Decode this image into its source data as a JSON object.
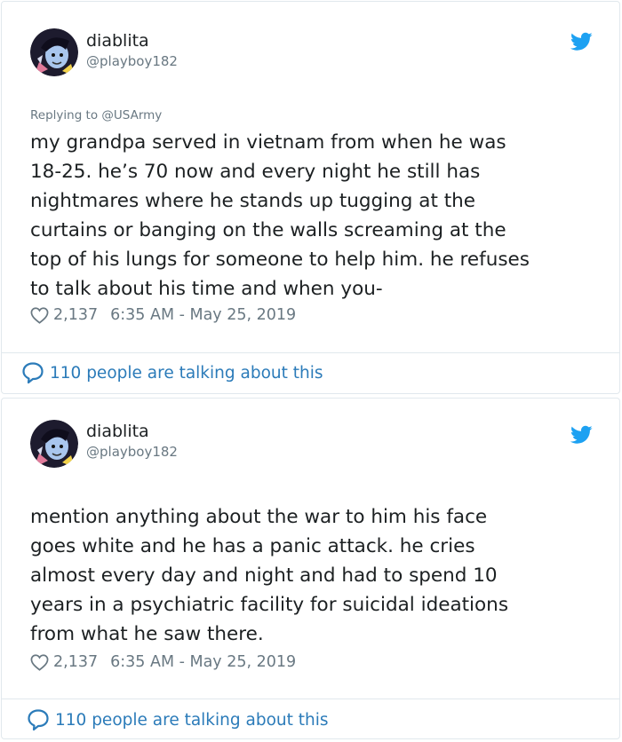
{
  "colors": {
    "text": "#1c2022",
    "muted": "#697882",
    "link": "#2b7bb9",
    "twitter_blue": "#1da1f2",
    "border": "#e1e8ed"
  },
  "tweets": [
    {
      "author_name": "diablita",
      "author_handle": "@playboy182",
      "reply_to": "Replying to @USArmy",
      "text": "my grandpa served in vietnam from when he was\n18-25. he’s 70 now and every night he still has\nnightmares where he stands up tugging at the\ncurtains or banging on the walls screaming at the\ntop of his lungs for someone to help him. he refuses\nto talk about his time and when you-",
      "likes": "2,137",
      "timestamp": "6:35 AM - May 25, 2019",
      "talking": "110 people are talking about this",
      "icons": {
        "avatar": "avatar-image",
        "brand": "twitter-bird-icon",
        "like": "heart-icon",
        "talk": "speech-bubble-icon"
      }
    },
    {
      "author_name": "diablita",
      "author_handle": "@playboy182",
      "text": "mention anything about the war to him his face\ngoes white and he has a panic attack. he cries\nalmost every day and night and had to spend 10\nyears in a psychiatric facility for suicidal ideations\nfrom what he saw there.",
      "likes": "2,137",
      "timestamp": "6:35 AM - May 25, 2019",
      "talking": "110 people are talking about this",
      "icons": {
        "avatar": "avatar-image",
        "brand": "twitter-bird-icon",
        "like": "heart-icon",
        "talk": "speech-bubble-icon"
      }
    }
  ]
}
